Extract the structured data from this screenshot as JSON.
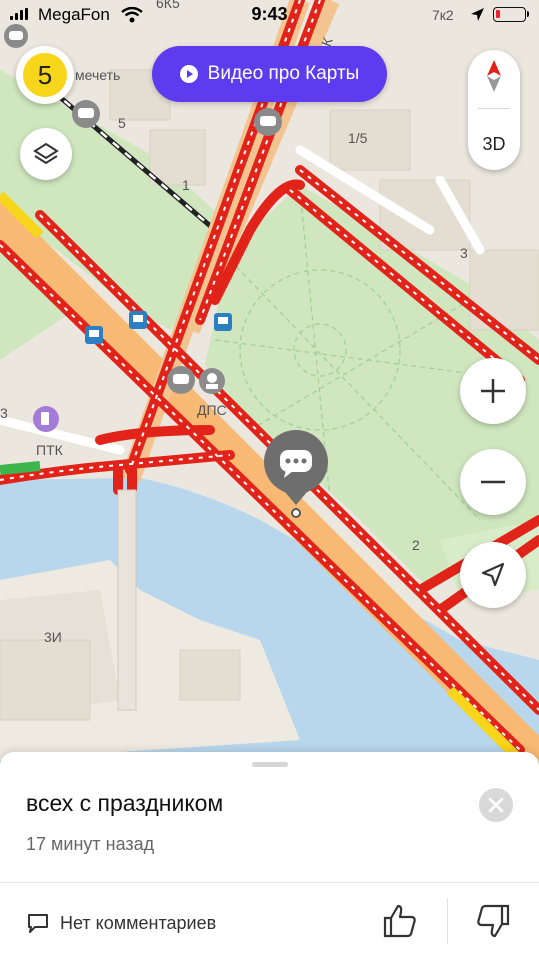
{
  "status_bar": {
    "carrier": "MegaFon",
    "time": "9:43"
  },
  "map": {
    "traffic_level": "5",
    "video_button_label": "Видео про Карты",
    "view_3d_label": "3D",
    "labels": {
      "street": "Ул. К",
      "house_6k5": "6К5",
      "house_7k2": "7к2",
      "house_5": "5",
      "house_1": "1",
      "house_1_5": "1/5",
      "house_3_right": "3",
      "house_3_left": "3",
      "house_2": "2",
      "house_3i": "3И",
      "mosque_fragment": "мечеть",
      "fuel_label": "ПТК",
      "police_label": "ДПС"
    }
  },
  "event_card": {
    "message": "всех с праздником",
    "time_ago": "17 минут назад",
    "comments_label": "Нет комментариев"
  },
  "colors": {
    "accent": "#5d3cf0",
    "traffic_yellow": "#f7d51a",
    "jam_red": "#e2231a",
    "park_green": "#cfe6bf",
    "water": "#b8d6ec"
  }
}
